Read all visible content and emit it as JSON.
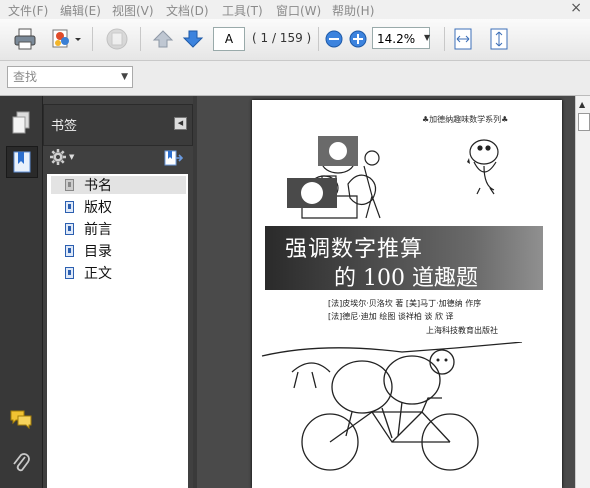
{
  "menu": {
    "items": [
      "文件(F)",
      "编辑(E)",
      "视图(V)",
      "文档(D)",
      "工具(T)",
      "窗口(W)",
      "帮助(H)"
    ],
    "close": "×"
  },
  "toolbar": {
    "page_value": "A",
    "page_count": "( 1 / 159 )",
    "zoom_value": "14.2%"
  },
  "find": {
    "placeholder": "查找"
  },
  "bookmarks_panel": {
    "title": "书签",
    "items": [
      "书名",
      "版权",
      "前言",
      "目录",
      "正文"
    ]
  },
  "cover": {
    "series": "♣加德纳趣味数学系列♣",
    "title_line1": "强调数字推算",
    "title_line2": "的 100 道趣题",
    "author_line1": "[法]皮埃尔·贝洛坎  著   [美]马丁·加德纳  作序",
    "author_line2": "[法]德尼·迪加   绘图   谈祥柏  谈  欣   译",
    "publisher": "上海科技教育出版社"
  },
  "colors": {
    "accent_blue": "#2c6fcf",
    "chrome_dark": "#404040"
  }
}
